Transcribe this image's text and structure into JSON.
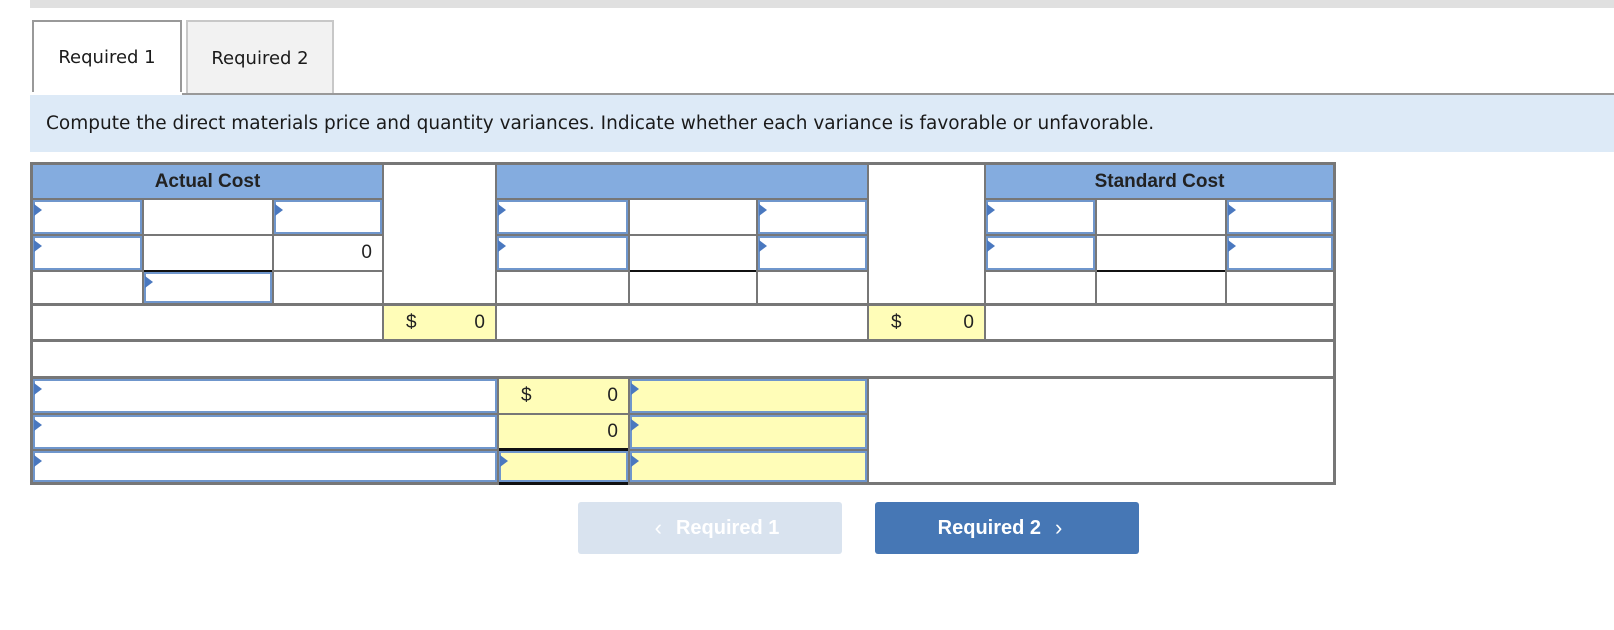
{
  "tabs": [
    {
      "label": "Required 1",
      "active": true
    },
    {
      "label": "Required 2",
      "active": false
    }
  ],
  "instructions": "Compute the direct materials price and quantity variances. Indicate whether each variance is favorable or unfavorable.",
  "grid": {
    "headers": {
      "actual": "Actual Cost",
      "middle": "",
      "standard": "Standard Cost"
    },
    "actual_row2_value": "0",
    "totals": {
      "actual_currency": "$",
      "actual_total": "0",
      "standard_currency": "$",
      "standard_total": "0"
    },
    "variances": [
      {
        "label": "",
        "currency": "$",
        "amount": "0",
        "type": ""
      },
      {
        "label": "",
        "currency": "",
        "amount": "0",
        "type": ""
      },
      {
        "label": "",
        "currency": "",
        "amount": "",
        "type": ""
      }
    ]
  },
  "nav": {
    "prev_label": "Required 1",
    "next_label": "Required 2",
    "prev_icon": "chevron-left-icon",
    "next_icon": "chevron-right-icon"
  },
  "colors": {
    "header_blue": "#84acdf",
    "input_border": "#6f96cc",
    "computed_yellow": "#fffdb8",
    "instruction_bg": "#ddeaf7",
    "next_button": "#4677b5",
    "prev_button_disabled": "#d9e3ef"
  }
}
